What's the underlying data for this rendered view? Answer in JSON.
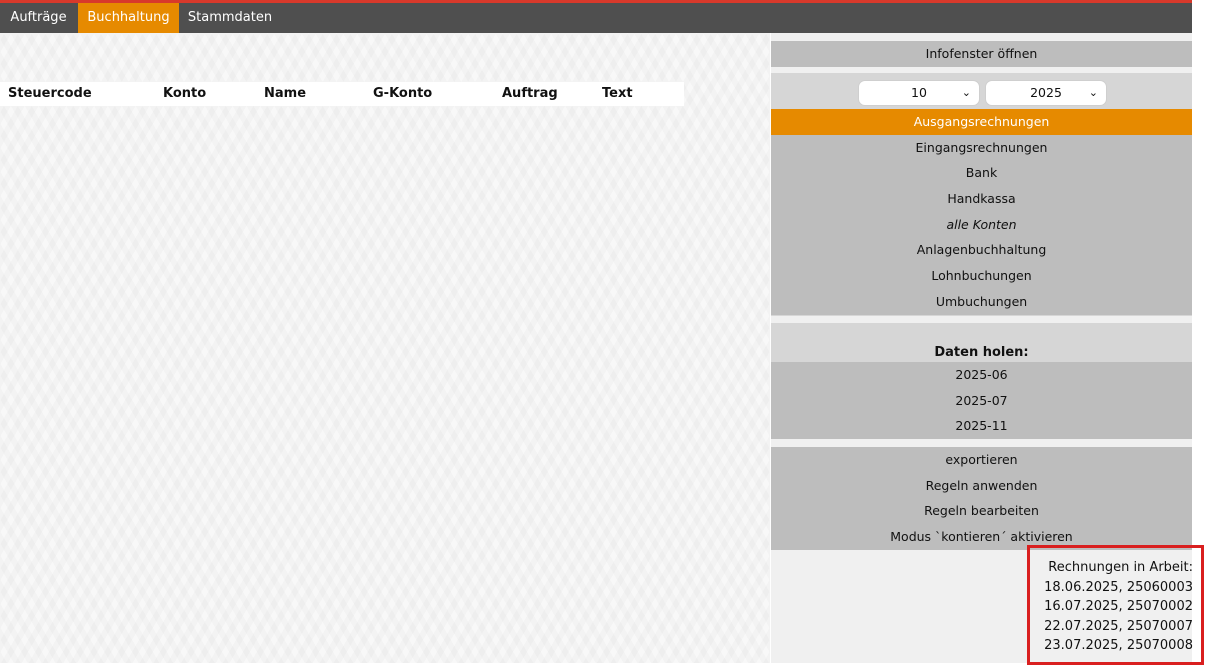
{
  "nav": {
    "tabs": [
      {
        "label": "Aufträge"
      },
      {
        "label": "Buchhaltung"
      },
      {
        "label": "Stammdaten"
      }
    ]
  },
  "table": {
    "headers": [
      "Steuercode",
      "Konto",
      "Name",
      "G-Konto",
      "Auftrag",
      "Text"
    ]
  },
  "sidebar": {
    "info_button": "Infofenster öffnen",
    "month_select": "10",
    "year_select": "2025",
    "accounts": [
      {
        "label": "Ausgangsrechnungen"
      },
      {
        "label": "Eingangsrechnungen"
      },
      {
        "label": "Bank"
      },
      {
        "label": "Handkassa"
      },
      {
        "label": "alle Konten"
      },
      {
        "label": "Anlagenbuchhaltung"
      },
      {
        "label": "Lohnbuchungen"
      },
      {
        "label": "Umbuchungen"
      }
    ],
    "fetch_title": "Daten holen:",
    "fetch_periods": [
      "2025-06",
      "2025-07",
      "2025-11"
    ],
    "actions": [
      {
        "label": "exportieren"
      },
      {
        "label": "Regeln anwenden"
      },
      {
        "label": "Regeln bearbeiten"
      },
      {
        "label": "Modus `kontieren´ aktivieren"
      }
    ],
    "invoices_title": "Rechnungen in Arbeit:",
    "invoices": [
      "18.06.2025, 25060003",
      "16.07.2025, 25070002",
      "22.07.2025, 25070007",
      "23.07.2025, 25070008"
    ]
  },
  "colors": {
    "accent": "#e68a00",
    "navbar": "#4f4f4f",
    "button": "#bdbdbd",
    "highlight": "#d91f1f"
  }
}
